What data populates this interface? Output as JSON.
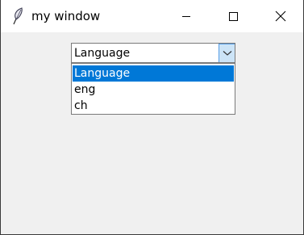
{
  "window": {
    "title": "my window",
    "icon": "feather-icon",
    "controls": {
      "minimize_icon": "minimize-icon",
      "maximize_icon": "maximize-icon",
      "close_icon": "close-icon"
    }
  },
  "combobox": {
    "value": "Language",
    "arrow_icon": "chevron-down-icon",
    "options": [
      "Language",
      "eng",
      "ch"
    ],
    "selected_index": 0
  },
  "colors": {
    "titlebar_bg": "#ffffff",
    "window_bg": "#f0f0f0",
    "selection_bg": "#0078d7",
    "arrow_bg": "#cce4f7",
    "arrow_border": "#569de5"
  }
}
